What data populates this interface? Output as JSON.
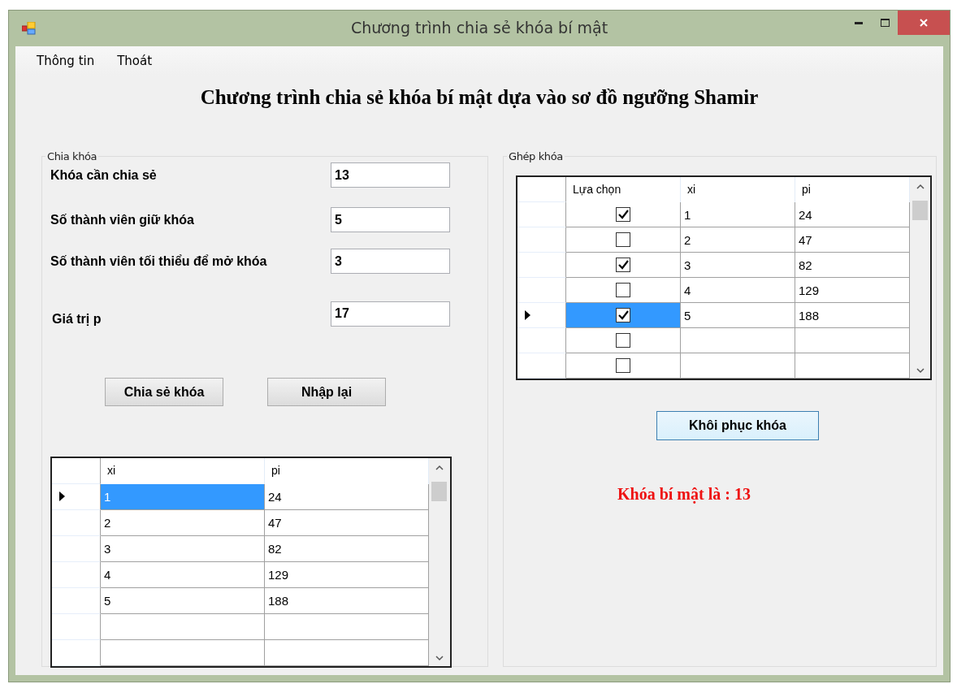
{
  "window": {
    "title": "Chương trình chia sẻ khóa bí mật"
  },
  "menu": [
    "Thông tin",
    "Thoát"
  ],
  "heading": "Chương trình chia sẻ khóa bí mật dựa vào sơ đồ ngưỡng Shamir",
  "split_group": {
    "title": "Chia khóa",
    "fields": [
      {
        "label": "Khóa cần chia sẻ",
        "value": "13"
      },
      {
        "label": "Số thành viên giữ khóa",
        "value": "5"
      },
      {
        "label": "Số thành viên tối thiểu để mở khóa",
        "value": "3"
      },
      {
        "label": "Giá trị p",
        "value": "17"
      }
    ],
    "buttons": [
      "Chia sẻ khóa",
      "Nhập lại"
    ],
    "table": {
      "columns": [
        "xi",
        "pi"
      ],
      "rows": [
        {
          "selected": true,
          "xi": "1",
          "pi": "24"
        },
        {
          "selected": false,
          "xi": "2",
          "pi": "47"
        },
        {
          "selected": false,
          "xi": "3",
          "pi": "82"
        },
        {
          "selected": false,
          "xi": "4",
          "pi": "129"
        },
        {
          "selected": false,
          "xi": "5",
          "pi": "188"
        }
      ]
    }
  },
  "join_group": {
    "title": "Ghép khóa",
    "table": {
      "columns": [
        "Lựa chọn",
        "xi",
        "pi"
      ],
      "rows": [
        {
          "selected": false,
          "checked": true,
          "xi": "1",
          "pi": "24"
        },
        {
          "selected": false,
          "checked": false,
          "xi": "2",
          "pi": "47"
        },
        {
          "selected": false,
          "checked": true,
          "xi": "3",
          "pi": "82"
        },
        {
          "selected": false,
          "checked": false,
          "xi": "4",
          "pi": "129"
        },
        {
          "selected": true,
          "checked": true,
          "xi": "5",
          "pi": "188"
        },
        {
          "selected": false,
          "checked": false
        },
        {
          "selected": false,
          "checked": false
        }
      ]
    },
    "button": "Khôi phục khóa",
    "result": "Khóa bí mật là : 13"
  }
}
